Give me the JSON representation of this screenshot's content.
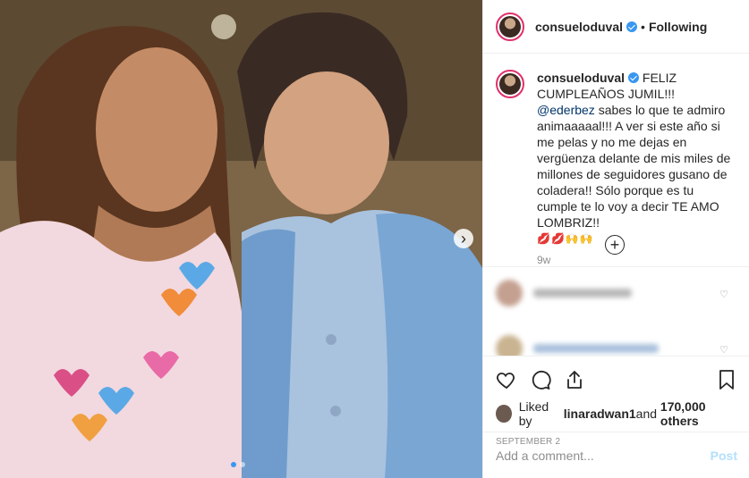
{
  "post": {
    "username": "consueloduval",
    "separator": "•",
    "follow_status": "Following",
    "caption_before_mention": "FELIZ CUMPLEAÑOS JUMIL!!! ",
    "mention": "@ederbez",
    "caption_after_mention": " sabes lo que te admiro animaaaaal!!! A ver si este año si me pelas y no me dejas en vergüenza delante de mis miles de millones de seguidores gusano de coladera!! Sólo porque es tu cumple te lo voy a decir TE AMO LOMBRIZ!!",
    "caption_emojis": "💋💋🙌🙌",
    "time_ago": "9w",
    "load_more_symbol": "+",
    "carousel_next_symbol": "›",
    "likes_prefix": "Liked by ",
    "liked_by_user": "linaradwan1",
    "likes_conjunction": " and ",
    "likes_count": "170,000 others",
    "date": "SEPTEMBER 2",
    "comment_placeholder": "Add a comment...",
    "post_button": "Post",
    "heart_symbol": "♡"
  },
  "icons": [
    "heart-icon",
    "comment-icon",
    "share-icon",
    "bookmark-icon",
    "verified-icon",
    "chevron-right-icon",
    "plus-circle-icon"
  ],
  "colors": {
    "verified": "#3897f0",
    "post_disabled": "#b2dffc",
    "mention": "#003569",
    "meta_gray": "#8e8e8e"
  }
}
